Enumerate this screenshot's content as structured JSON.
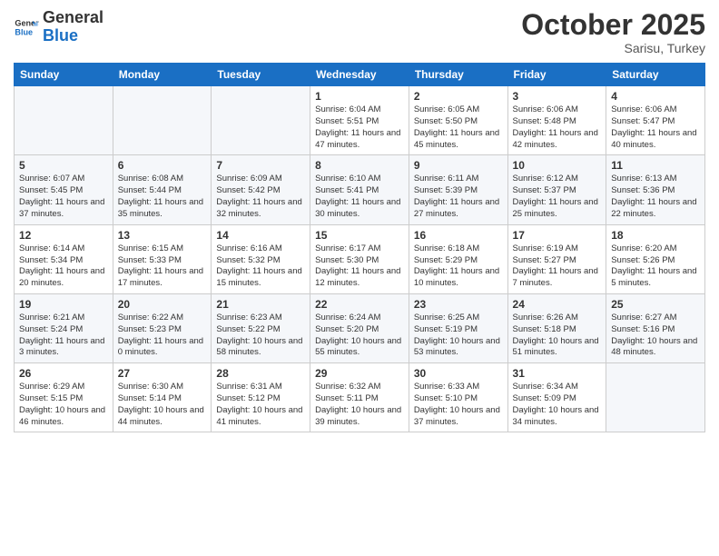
{
  "logo": {
    "text_general": "General",
    "text_blue": "Blue"
  },
  "header": {
    "month": "October 2025",
    "location": "Sarisu, Turkey"
  },
  "days_of_week": [
    "Sunday",
    "Monday",
    "Tuesday",
    "Wednesday",
    "Thursday",
    "Friday",
    "Saturday"
  ],
  "weeks": [
    [
      {
        "day": "",
        "info": ""
      },
      {
        "day": "",
        "info": ""
      },
      {
        "day": "",
        "info": ""
      },
      {
        "day": "1",
        "info": "Sunrise: 6:04 AM\nSunset: 5:51 PM\nDaylight: 11 hours\nand 47 minutes."
      },
      {
        "day": "2",
        "info": "Sunrise: 6:05 AM\nSunset: 5:50 PM\nDaylight: 11 hours\nand 45 minutes."
      },
      {
        "day": "3",
        "info": "Sunrise: 6:06 AM\nSunset: 5:48 PM\nDaylight: 11 hours\nand 42 minutes."
      },
      {
        "day": "4",
        "info": "Sunrise: 6:06 AM\nSunset: 5:47 PM\nDaylight: 11 hours\nand 40 minutes."
      }
    ],
    [
      {
        "day": "5",
        "info": "Sunrise: 6:07 AM\nSunset: 5:45 PM\nDaylight: 11 hours\nand 37 minutes."
      },
      {
        "day": "6",
        "info": "Sunrise: 6:08 AM\nSunset: 5:44 PM\nDaylight: 11 hours\nand 35 minutes."
      },
      {
        "day": "7",
        "info": "Sunrise: 6:09 AM\nSunset: 5:42 PM\nDaylight: 11 hours\nand 32 minutes."
      },
      {
        "day": "8",
        "info": "Sunrise: 6:10 AM\nSunset: 5:41 PM\nDaylight: 11 hours\nand 30 minutes."
      },
      {
        "day": "9",
        "info": "Sunrise: 6:11 AM\nSunset: 5:39 PM\nDaylight: 11 hours\nand 27 minutes."
      },
      {
        "day": "10",
        "info": "Sunrise: 6:12 AM\nSunset: 5:37 PM\nDaylight: 11 hours\nand 25 minutes."
      },
      {
        "day": "11",
        "info": "Sunrise: 6:13 AM\nSunset: 5:36 PM\nDaylight: 11 hours\nand 22 minutes."
      }
    ],
    [
      {
        "day": "12",
        "info": "Sunrise: 6:14 AM\nSunset: 5:34 PM\nDaylight: 11 hours\nand 20 minutes."
      },
      {
        "day": "13",
        "info": "Sunrise: 6:15 AM\nSunset: 5:33 PM\nDaylight: 11 hours\nand 17 minutes."
      },
      {
        "day": "14",
        "info": "Sunrise: 6:16 AM\nSunset: 5:32 PM\nDaylight: 11 hours\nand 15 minutes."
      },
      {
        "day": "15",
        "info": "Sunrise: 6:17 AM\nSunset: 5:30 PM\nDaylight: 11 hours\nand 12 minutes."
      },
      {
        "day": "16",
        "info": "Sunrise: 6:18 AM\nSunset: 5:29 PM\nDaylight: 11 hours\nand 10 minutes."
      },
      {
        "day": "17",
        "info": "Sunrise: 6:19 AM\nSunset: 5:27 PM\nDaylight: 11 hours\nand 7 minutes."
      },
      {
        "day": "18",
        "info": "Sunrise: 6:20 AM\nSunset: 5:26 PM\nDaylight: 11 hours\nand 5 minutes."
      }
    ],
    [
      {
        "day": "19",
        "info": "Sunrise: 6:21 AM\nSunset: 5:24 PM\nDaylight: 11 hours\nand 3 minutes."
      },
      {
        "day": "20",
        "info": "Sunrise: 6:22 AM\nSunset: 5:23 PM\nDaylight: 11 hours\nand 0 minutes."
      },
      {
        "day": "21",
        "info": "Sunrise: 6:23 AM\nSunset: 5:22 PM\nDaylight: 10 hours\nand 58 minutes."
      },
      {
        "day": "22",
        "info": "Sunrise: 6:24 AM\nSunset: 5:20 PM\nDaylight: 10 hours\nand 55 minutes."
      },
      {
        "day": "23",
        "info": "Sunrise: 6:25 AM\nSunset: 5:19 PM\nDaylight: 10 hours\nand 53 minutes."
      },
      {
        "day": "24",
        "info": "Sunrise: 6:26 AM\nSunset: 5:18 PM\nDaylight: 10 hours\nand 51 minutes."
      },
      {
        "day": "25",
        "info": "Sunrise: 6:27 AM\nSunset: 5:16 PM\nDaylight: 10 hours\nand 48 minutes."
      }
    ],
    [
      {
        "day": "26",
        "info": "Sunrise: 6:29 AM\nSunset: 5:15 PM\nDaylight: 10 hours\nand 46 minutes."
      },
      {
        "day": "27",
        "info": "Sunrise: 6:30 AM\nSunset: 5:14 PM\nDaylight: 10 hours\nand 44 minutes."
      },
      {
        "day": "28",
        "info": "Sunrise: 6:31 AM\nSunset: 5:12 PM\nDaylight: 10 hours\nand 41 minutes."
      },
      {
        "day": "29",
        "info": "Sunrise: 6:32 AM\nSunset: 5:11 PM\nDaylight: 10 hours\nand 39 minutes."
      },
      {
        "day": "30",
        "info": "Sunrise: 6:33 AM\nSunset: 5:10 PM\nDaylight: 10 hours\nand 37 minutes."
      },
      {
        "day": "31",
        "info": "Sunrise: 6:34 AM\nSunset: 5:09 PM\nDaylight: 10 hours\nand 34 minutes."
      },
      {
        "day": "",
        "info": ""
      }
    ]
  ]
}
